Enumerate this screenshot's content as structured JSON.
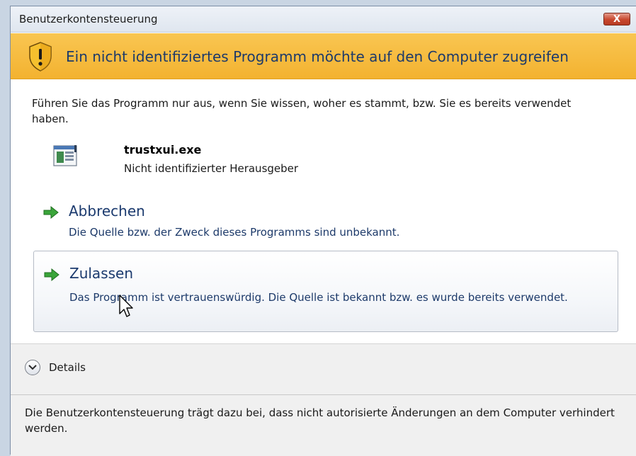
{
  "window": {
    "title": "Benutzerkontensteuerung",
    "close_label": "X"
  },
  "banner": {
    "icon": "warning-shield-icon",
    "text": "Ein nicht identifiziertes Programm möchte auf den Computer zugreifen",
    "color": "#f3b230"
  },
  "intro": "Führen Sie das Programm nur aus, wenn Sie wissen, woher es stammt, bzw. Sie es bereits verwendet haben.",
  "program": {
    "icon": "application-icon",
    "name": "trustxui.exe",
    "publisher": "Nicht identifizierter Herausgeber"
  },
  "options": {
    "cancel": {
      "icon": "green-arrow-icon",
      "title": "Abbrechen",
      "description": "Die Quelle bzw. der Zweck dieses Programms sind unbekannt."
    },
    "allow": {
      "icon": "green-arrow-icon",
      "title": "Zulassen",
      "description": "Das Programm ist vertrauenswürdig. Die Quelle ist bekannt bzw. es wurde bereits verwendet."
    }
  },
  "details": {
    "icon": "chevron-down-icon",
    "label": "Details"
  },
  "footer": {
    "text": "Die Benutzerkontensteuerung trägt dazu bei, dass nicht autorisierte Änderungen an dem Computer verhindert werden."
  }
}
